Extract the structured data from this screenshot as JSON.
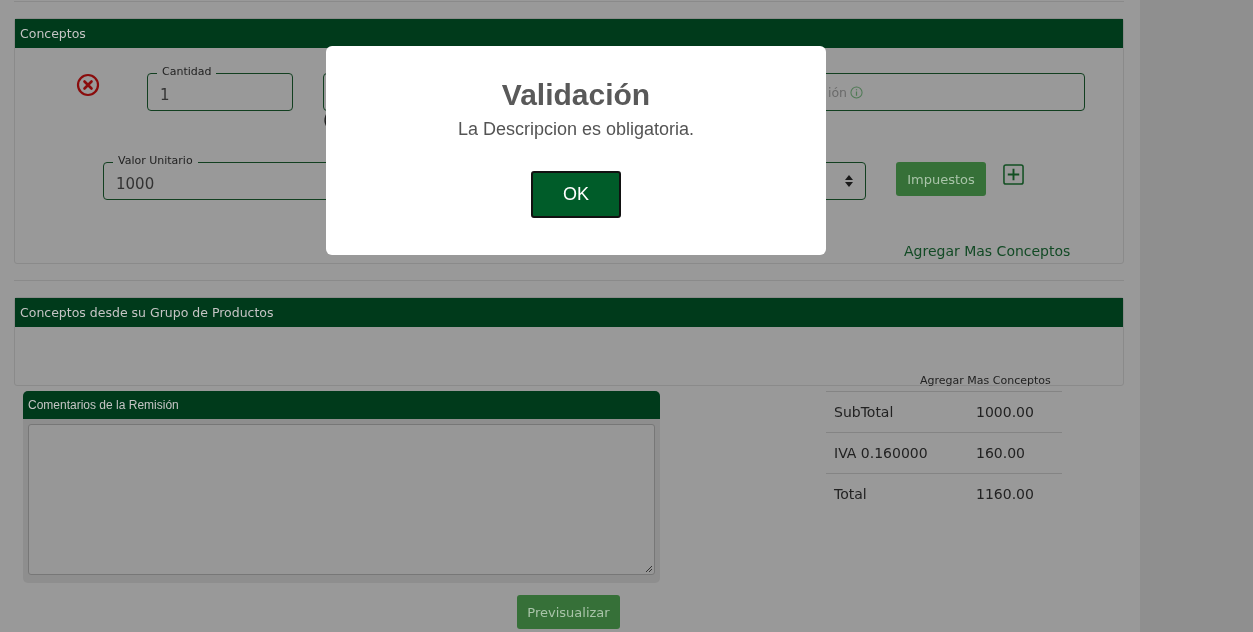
{
  "conceptos": {
    "title": "Conceptos",
    "quantity": {
      "label": "Cantidad",
      "value": "1"
    },
    "fragment": "(",
    "description": {
      "placeholder": "ión"
    },
    "unit_value": {
      "label": "Valor Unitario",
      "value": "1000"
    },
    "taxes_button": "Impuestos",
    "add_link": "Agregar Mas Conceptos"
  },
  "grupo": {
    "title": "Conceptos desde su Grupo de Productos",
    "add_link": "Agregar Mas Conceptos"
  },
  "comments": {
    "title": "Comentarios de la Remisión"
  },
  "totals": [
    {
      "label": "SubTotal",
      "value": "1000.00"
    },
    {
      "label": "IVA 0.160000",
      "value": "160.00"
    },
    {
      "label": "Total",
      "value": "1160.00"
    }
  ],
  "preview_button": "Previsualizar",
  "dialog": {
    "title": "Validación",
    "message": "La Descripcion es obligatoria.",
    "button": "OK"
  }
}
